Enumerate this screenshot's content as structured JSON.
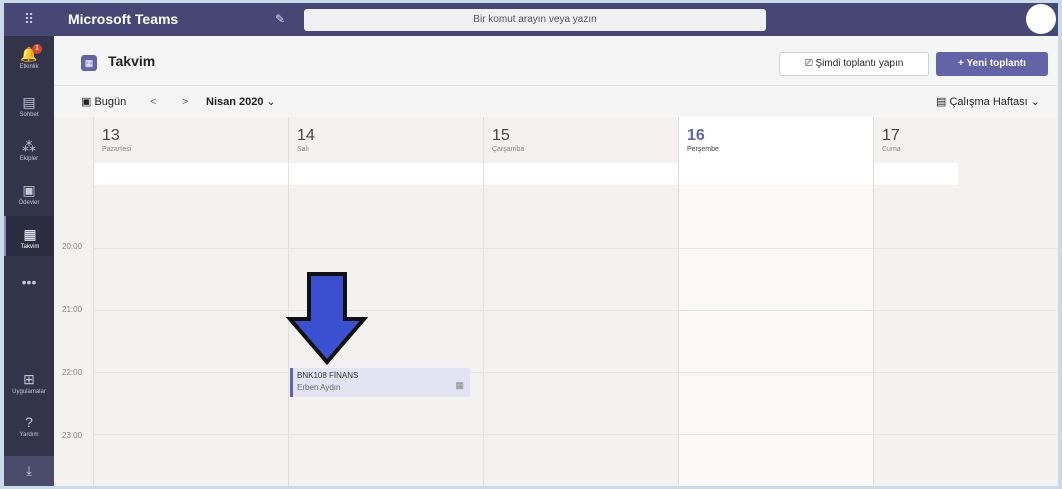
{
  "app": {
    "title": "Microsoft Teams",
    "search_placeholder": "Bir komut arayın veya yazın",
    "apps_icon": "⠿",
    "compose_icon": "✎"
  },
  "rail": {
    "items": [
      {
        "label": "Etkinlik",
        "icon": "🔔",
        "badge": "1"
      },
      {
        "label": "Sohbet",
        "icon": "▤"
      },
      {
        "label": "Ekipler",
        "icon": "⁂"
      },
      {
        "label": "Ödevler",
        "icon": "▣"
      },
      {
        "label": "Takvim",
        "icon": "▦"
      },
      {
        "label": "",
        "icon": "•••"
      },
      {
        "label": "Uygulamalar",
        "icon": "⊞"
      },
      {
        "label": "Yardım",
        "icon": "?"
      }
    ],
    "download_icon": "⤓"
  },
  "header": {
    "title": "Takvim",
    "meet_now": "Şimdi toplantı yapın",
    "new_meeting": "Yeni toplantı"
  },
  "toolbar": {
    "today": "Bugün",
    "prev": "<",
    "next": ">",
    "month": "Nisan 2020",
    "view": "Çalışma Haftası"
  },
  "days": [
    {
      "num": "13",
      "name": "Pazartesi"
    },
    {
      "num": "14",
      "name": "Salı"
    },
    {
      "num": "15",
      "name": "Çarşamba"
    },
    {
      "num": "16",
      "name": "Perşembe"
    },
    {
      "num": "17",
      "name": "Cuma"
    }
  ],
  "times": [
    "20:00",
    "21:00",
    "22:00",
    "23:00"
  ],
  "event": {
    "title": "BNK108 FİNANS",
    "organizer": "Erben Aydın"
  },
  "colors": {
    "brand": "#6264a7",
    "topbar": "#464775",
    "rail": "#33344a",
    "arrow": "#3b4fd1"
  }
}
